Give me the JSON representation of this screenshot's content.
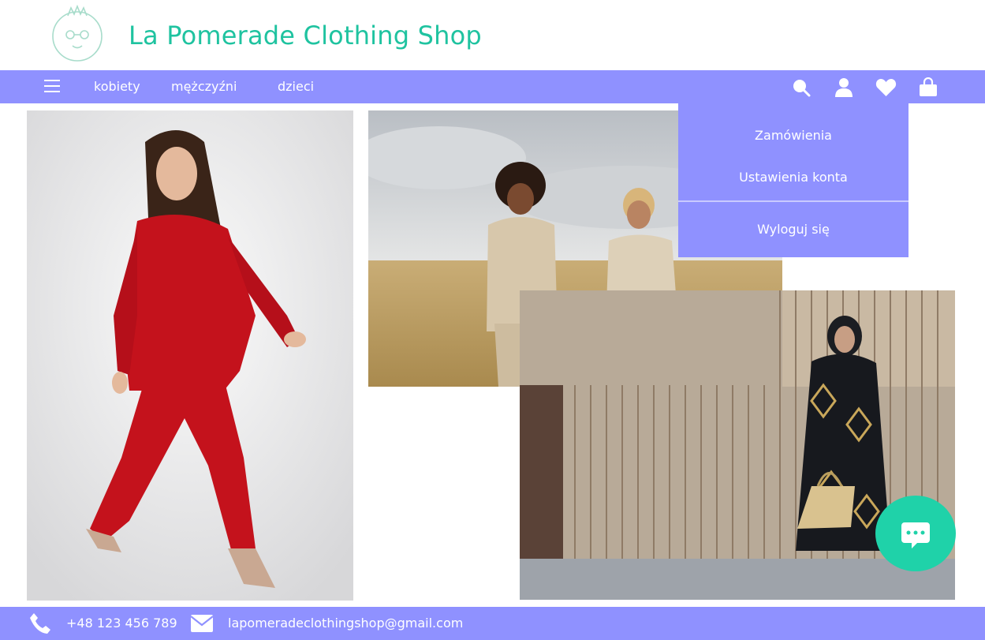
{
  "brand": {
    "title": "La Pomerade Clothing Shop",
    "accent_color": "#1fc3a0",
    "logo_icon": "pomegranate-face-logo"
  },
  "nav": {
    "menu_icon": "hamburger-icon",
    "links": [
      "kobiety",
      "mężczyźni",
      "dzieci"
    ],
    "icons": [
      "search-icon",
      "user-icon",
      "heart-icon",
      "shopping-bag-icon"
    ],
    "bar_color": "#8f91ff"
  },
  "account_menu": {
    "items": [
      "Zamówienia",
      "Ustawienia konta"
    ],
    "logout": "Wyloguj się"
  },
  "footer": {
    "phone": "+48 123 456 789",
    "email": "lapomeradeclothingshop@gmail.com",
    "phone_icon": "phone-icon",
    "email_icon": "mail-icon"
  },
  "chat": {
    "icon": "chat-bubble-icon",
    "color": "#1fd2a9"
  }
}
